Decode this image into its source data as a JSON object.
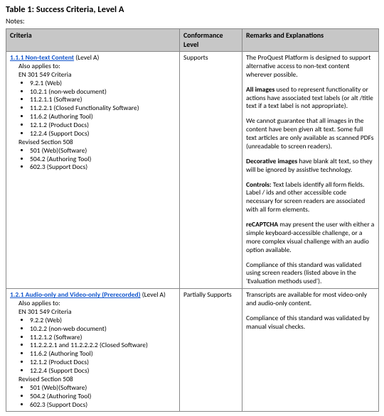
{
  "title": "Table 1: Success Criteria, Level A",
  "notes_label": "Notes:",
  "headers": {
    "c1": "Criteria",
    "c2": "Conformance Level",
    "c3": "Remarks and Explanations"
  },
  "row1": {
    "link": "1.1.1 Non-text Content",
    "level": " (Level A)",
    "also": "Also applies to:",
    "en": "EN 301 549 Criteria",
    "b1": "9.2.1 (Web)",
    "b2": "10.2.1 (non-web document)",
    "b3": "11.2.1.1 (Software)",
    "b4": "11.2.2.1 (Closed Functionality Software)",
    "b5": "11.6.2 (Authoring Tool)",
    "b6": "12.1.2 (Product Docs)",
    "b7": "12.2.4 (Support Docs)",
    "rev": "Revised Section 508",
    "r1": "501 (Web)(Software)",
    "r2": "504.2 (Authoring Tool)",
    "r3": "602.3 (Support Docs)",
    "conf": "Supports",
    "p1": "The ProQuest Platform is designed to support alternative access to non-text content wherever possible.",
    "p2a": "All images",
    "p2b": " used to represent functionality or actions have associated text labels (or alt /title text if a text label is not appropriate).",
    "p3": "We cannot guarantee that all images in the content have been given alt text. Some full text articles are only available as scanned PDFs (unreadable to screen readers).",
    "p4a": "Decorative images",
    "p4b": " have blank alt text, so they will be ignored by assistive technology.",
    "p5a": "Controls:",
    "p5b": " Text labels identify all form fields. Label / ids and other accessible code necessary for screen readers are associated with all form elements.",
    "p6a": "reCAPTCHA",
    "p6b": " may present the user with either a simple keyboard-accessible challenge, or a more complex visual challenge with an audio option available.",
    "p7": "Compliance of this standard was validated using screen readers (listed above in the 'Evaluation methods used')."
  },
  "row2": {
    "link": "1.2.1 Audio-only and Video-only (Prerecorded)",
    "level": " (Level A)",
    "also": "Also applies to:",
    "en": "EN 301 549 Criteria",
    "b1": "9.2.2 (Web)",
    "b2": "10.2.2 (non-web document)",
    "b3": "11.2.1.2 (Software)",
    "b4": "11.2.2.2.1 and 11.2.2.2.2 (Closed Software)",
    "b5": "11.6.2 (Authoring Tool)",
    "b6": "12.1.2 (Product Docs)",
    "b7": "12.2.4 (Support Docs)",
    "rev": "Revised Section 508",
    "r1": "501 (Web)(Software)",
    "r2": "504.2 (Authoring Tool)",
    "r3": "602.3 (Support Docs)",
    "conf": "Partially Supports",
    "p1": "Transcripts are available for most video-only and audio-only content.",
    "p2": "Compliance of this standard was validated by manual visual checks."
  }
}
